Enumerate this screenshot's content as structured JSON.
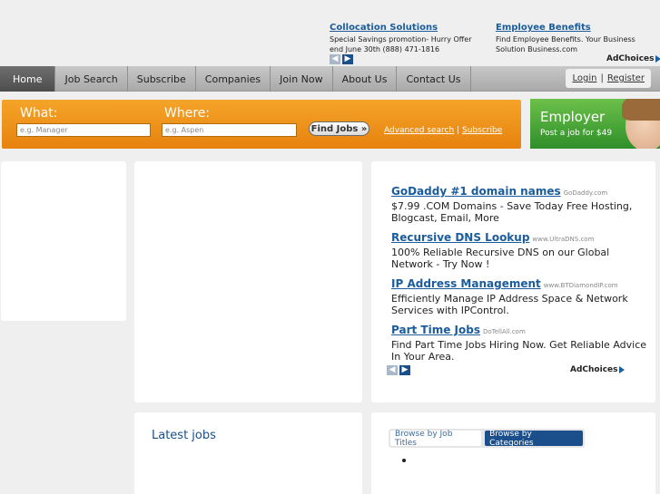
{
  "top_ads": [
    {
      "title": "Collocation Solutions",
      "desc": "Special Savings promotion- Hurry Offer end June 30th (888) 471-1816"
    },
    {
      "title": "Employee Benefits",
      "desc": "Find Employee Benefits. Your Business Solution Business.com"
    }
  ],
  "adchoices_label": "AdChoices",
  "arrows": {
    "prev": "◀",
    "next": "▶"
  },
  "nav": {
    "items": [
      "Home",
      "Job Search",
      "Subscribe",
      "Companies",
      "Join Now",
      "About Us",
      "Contact Us"
    ],
    "login": "Login",
    "separator": "|",
    "register": "Register"
  },
  "search": {
    "what_label": "What:",
    "where_label": "Where:",
    "what_placeholder": "e.g. Manager",
    "where_placeholder": "e.g. Aspen",
    "find_button": "Find Jobs »",
    "advanced_link": "Advanced search",
    "separator": "|",
    "subscribe_link": "Subscribe"
  },
  "employer": {
    "title": "Employer",
    "subtitle": "Post a job for $49"
  },
  "right_ads": [
    {
      "title": "GoDaddy #1 domain names",
      "domain": "GoDaddy.com",
      "desc": "$7.99 .COM Domains - Save Today Free Hosting, Blogcast, Email, More"
    },
    {
      "title": "Recursive DNS Lookup",
      "domain": "www.UltraDNS.com",
      "desc": "100% Reliable Recursive DNS on our Global Network - Try Now !"
    },
    {
      "title": "IP Address Management",
      "domain": "www.BTDiamondIP.com",
      "desc": "Efficiently Manage IP Address Space & Network Services with IPControl."
    },
    {
      "title": "Part Time Jobs",
      "domain": "DoTellAll.com",
      "desc": "Find Part Time Jobs Hiring Now. Get Reliable Advice In Your Area."
    }
  ],
  "latest": {
    "title": "Latest jobs"
  },
  "browse": {
    "tab_titles": "Browse by Job Titles",
    "tab_categories": "Browse by Categories"
  },
  "colors": {
    "accent_orange": "#f39a1f",
    "link_blue": "#1a5c9c",
    "employer_green": "#4caf3a"
  }
}
